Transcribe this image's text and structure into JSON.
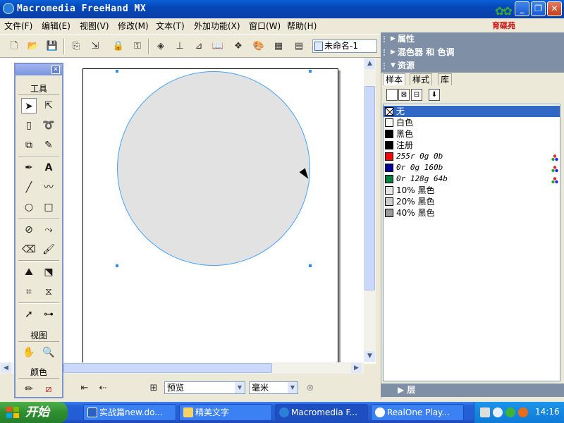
{
  "window": {
    "title": "Macromedia FreeHand MX",
    "logo_text": "育碟苑"
  },
  "menu": {
    "items": [
      "文件(F)",
      "编辑(E)",
      "视图(V)",
      "修改(M)",
      "文本(T)",
      "外加功能(X)",
      "窗口(W)",
      "帮助(H)"
    ]
  },
  "toolbar": {
    "document_name": "未命名-1"
  },
  "tools_panel": {
    "tools_label": "工具",
    "view_label": "视图",
    "color_label": "颜色"
  },
  "status": {
    "preview_mode": "预览",
    "units": "毫米"
  },
  "right_panel": {
    "properties_label": "属性",
    "mixer_label": "混色器 和 色调",
    "assets_label": "资源",
    "layers_label": "层",
    "tabs": [
      "样本",
      "样式",
      "库"
    ],
    "swatches": [
      {
        "name": "无",
        "color": "#ffffff",
        "selected": true
      },
      {
        "name": "白色",
        "color": "#ffffff"
      },
      {
        "name": "黑色",
        "color": "#000000"
      },
      {
        "name": "注册",
        "color": "#000000"
      },
      {
        "name": "255r 0g 0b",
        "color": "#ff0000",
        "italic": true
      },
      {
        "name": "0r 0g 160b",
        "color": "#0000a0",
        "italic": true
      },
      {
        "name": "0r 128g 64b",
        "color": "#008040",
        "italic": true
      },
      {
        "name": "10% 黑色",
        "color": "#e6e6e6"
      },
      {
        "name": "20% 黑色",
        "color": "#cccccc"
      },
      {
        "name": "40% 黑色",
        "color": "#999999"
      }
    ]
  },
  "taskbar": {
    "start_label": "开始",
    "tasks": [
      "实战篇new.do...",
      "精美文字",
      "Macromedia F...",
      "RealOne Play..."
    ],
    "clock": "14:16"
  },
  "colors": {
    "panel_head": "#7e8fa6",
    "selection": "#3168c6",
    "circle_fill": "#e2e2e2",
    "circle_stroke": "#3ea4ff"
  }
}
